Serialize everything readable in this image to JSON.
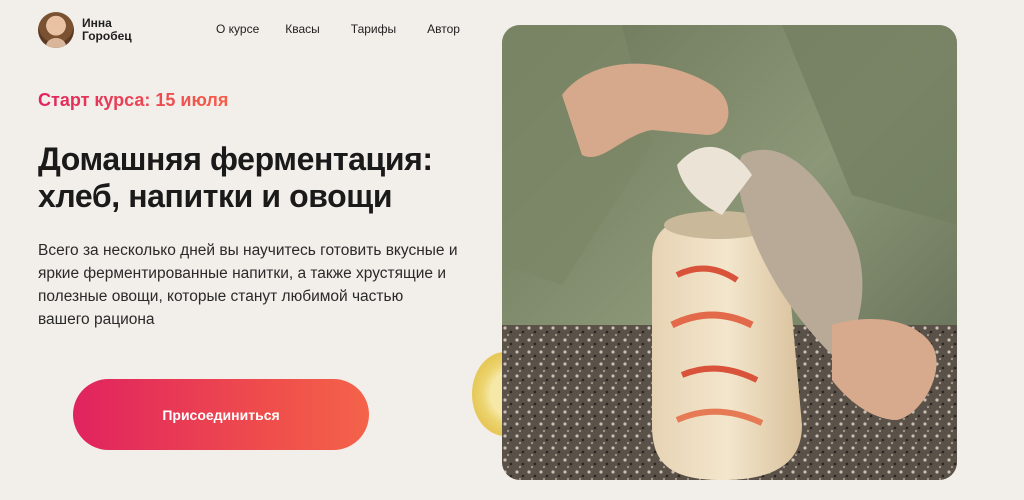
{
  "brand": {
    "name": "Инна Горобец"
  },
  "nav": {
    "items": [
      "О курсе",
      "Квасы",
      "Тарифы",
      "Автор"
    ]
  },
  "hero": {
    "start": "Старт курса: 15 июля",
    "title": "Домашняя ферментация: хлеб, напитки и овощи",
    "description": "Всего за несколько дней вы научитесь готовить вкусные и яркие ферментированные напитки, а также хрустящие и полезные овощи, которые станут любимой частью вашего рациона",
    "cta_label": "Присоединиться"
  },
  "colors": {
    "background": "#f2eee9",
    "accent_start": "#e0245e",
    "accent_end": "#f4634a"
  },
  "icons": {
    "avatar": "author-photo",
    "hero_image": "fermentation-jar-photo"
  }
}
